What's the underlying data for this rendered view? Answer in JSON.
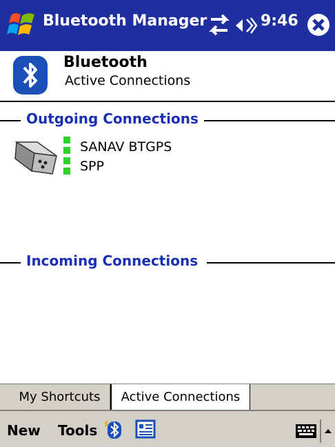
{
  "titlebar": {
    "app_title": "Bluetooth Manager",
    "time": "9:46",
    "icons": [
      "windows-logo-icon",
      "connectivity-icon",
      "volume-icon",
      "close-icon"
    ]
  },
  "header": {
    "title": "Bluetooth",
    "subtitle": "Active Connections",
    "icon": "bluetooth-icon"
  },
  "sections": {
    "outgoing_label": "Outgoing Connections",
    "incoming_label": "Incoming Connections"
  },
  "outgoing": [
    {
      "name": "SANAV BTGPS"
    },
    {
      "name": "SPP"
    }
  ],
  "tabs": [
    {
      "label": "My Shortcuts"
    },
    {
      "label": "Active Connections"
    }
  ],
  "menubar": {
    "new_label": "New",
    "tools_label": "Tools",
    "icons": [
      "bluetooth-menu-icon",
      "contact-card-icon",
      "keyboard-icon",
      "up-arrow-icon"
    ]
  },
  "colors": {
    "titlebar": "#1f2f9f",
    "section_label": "#1a2fb5",
    "signal": "#2bd32b",
    "menubar": "#d4d0c8"
  }
}
